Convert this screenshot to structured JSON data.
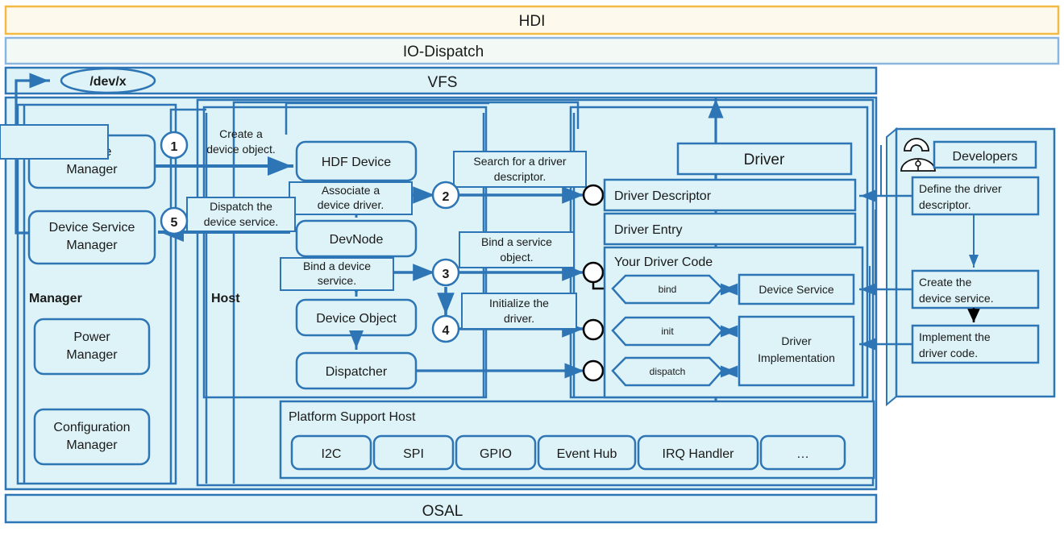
{
  "layers": {
    "hdi": "HDI",
    "io_dispatch": "IO-Dispatch",
    "vfs": "VFS",
    "osal": "OSAL",
    "devnode_path": "/dev/x"
  },
  "manager": {
    "title": "Manager",
    "items": [
      "Device\nManager",
      "Device Service\nManager",
      "Power\nManager",
      "Configuration\nManager"
    ],
    "device_manager_line1": "Device",
    "device_manager_line2": "Manager",
    "device_service_manager_line1": "Device Service",
    "device_service_manager_line2": "Manager",
    "power_manager_line1": "Power",
    "power_manager_line2": "Manager",
    "configuration_manager_line1": "Configuration",
    "configuration_manager_line2": "Manager"
  },
  "host": {
    "title": "Host",
    "nodes": {
      "hdf_device": "HDF Device",
      "devnode": "DevNode",
      "device_object": "Device Object",
      "dispatcher": "Dispatcher"
    }
  },
  "steps": [
    {
      "num": "1",
      "label_line1": "Create a",
      "label_line2": "device object."
    },
    {
      "num": "2",
      "label_line1": "Search for a driver",
      "label_line2": "descriptor."
    },
    {
      "num": "3",
      "label_line1": "Bind a service",
      "label_line2": "object."
    },
    {
      "num": "4",
      "label_line1": "Initialize the",
      "label_line2": "driver."
    },
    {
      "num": "5",
      "label_line1": "Dispatch the",
      "label_line2": "device service."
    }
  ],
  "inline_labels": {
    "associate_line1": "Associate a",
    "associate_line2": "device driver.",
    "bind_device_line1": "Bind a device",
    "bind_device_line2": "service."
  },
  "driver": {
    "title": "Driver",
    "descriptor": "Driver Descriptor",
    "entry": "Driver Entry",
    "your_code": "Your Driver Code",
    "hooks": [
      "bind",
      "init",
      "dispatch"
    ],
    "hook_bind": "bind",
    "hook_init": "init",
    "hook_dispatch": "dispatch",
    "device_service": "Device Service",
    "driver_impl_line1": "Driver",
    "driver_impl_line2": "Implementation"
  },
  "platform_support_host": {
    "title": "Platform Support Host",
    "modules": [
      "I2C",
      "SPI",
      "GPIO",
      "Event Hub",
      "IRQ Handler",
      "…"
    ],
    "m0": "I2C",
    "m1": "SPI",
    "m2": "GPIO",
    "m3": "Event Hub",
    "m4": "IRQ Handler",
    "m5": "…"
  },
  "developers": {
    "title": "Developers",
    "tasks": [
      {
        "line1": "Define the driver",
        "line2": "descriptor."
      },
      {
        "line1": "Create the",
        "line2": "device service."
      },
      {
        "line1": "Implement the",
        "line2": "driver code."
      }
    ],
    "t0_l1": "Define the driver",
    "t0_l2": "descriptor.",
    "t1_l1": "Create the",
    "t1_l2": "device service.",
    "t2_l1": "Implement the",
    "t2_l2": "driver code."
  },
  "colors": {
    "panel_fill": "#ddf3f7",
    "panel_stroke": "#2e75b6",
    "hdi_fill": "#fdf9ec",
    "hdi_stroke": "#f4b942",
    "io_fill": "#f3faf5",
    "io_stroke": "#8ab6e0",
    "arrow": "#2e75b6",
    "text": "#1a1a1a",
    "white": "#ffffff"
  }
}
